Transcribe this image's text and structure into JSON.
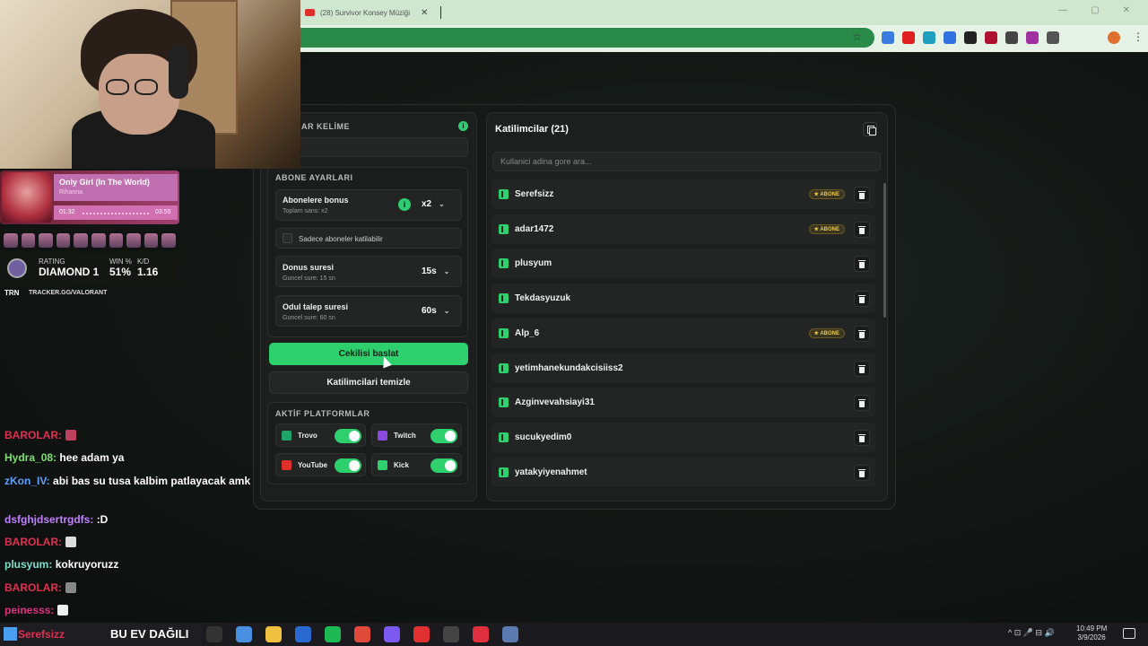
{
  "browser": {
    "tab_title": "(28) Survivor Konsey Müziği",
    "tab_close": "✕",
    "star": "☆",
    "menu": "⋮",
    "window_buttons": [
      "—",
      "▢",
      "✕"
    ],
    "extensions": [
      "#3a7be0",
      "#e02020",
      "#20a0c0",
      "#3070e0",
      "#222222",
      "#b01030",
      "#444444",
      "#a030a0",
      "#555555"
    ]
  },
  "keyword": {
    "title": "AR KELİME",
    "info": "i"
  },
  "abone": {
    "title": "ABONE AYARLARI",
    "bonus": {
      "label": "Abonelere bonus",
      "sub": "Toplam sans: x2",
      "info": "i",
      "value": "x2"
    },
    "only_subs": {
      "label": "Sadece aboneler katilabilir"
    },
    "duration": {
      "label": "Donus suresi",
      "sub": "Guncel sure: 15 sn",
      "value": "15s"
    },
    "claim": {
      "label": "Odul talep suresi",
      "sub": "Guncel sure: 60 sn",
      "value": "60s"
    },
    "chevron": "⌄"
  },
  "buttons": {
    "start": "Cekilisi baslat",
    "clear": "Katilimcilari temizle"
  },
  "platforms": {
    "title": "AKTİF PLATFORMLAR",
    "items": [
      {
        "name": "Trovo",
        "color": "#1fa56a"
      },
      {
        "name": "Twitch",
        "color": "#8a4ae0"
      },
      {
        "name": "YouTube",
        "color": "#e0302a"
      },
      {
        "name": "Kick",
        "color": "#2ed06e"
      }
    ]
  },
  "participants": {
    "title": "Katilimcilar (21)",
    "search_placeholder": "Kullanici adina gore ara...",
    "badge": "★ ABONE",
    "items": [
      {
        "name": "Serefsizz",
        "abone": true
      },
      {
        "name": "adar1472",
        "abone": true
      },
      {
        "name": "plusyum",
        "abone": false
      },
      {
        "name": "Tekdasyuzuk",
        "abone": false
      },
      {
        "name": "Alp_6",
        "abone": true
      },
      {
        "name": "yetimhanekundakcisiiss2",
        "abone": false
      },
      {
        "name": "Azginvevahsiayi31",
        "abone": false
      },
      {
        "name": "sucukyedim0",
        "abone": false
      },
      {
        "name": "yatakyiyenahmet",
        "abone": false
      }
    ]
  },
  "music": {
    "song": "Only Girl (In The World)",
    "artist": "Rihanna",
    "current": "01:32",
    "length": "03:55"
  },
  "rating": {
    "rating_label": "RATING",
    "rating_value": "DIAMOND 1",
    "win_label": "WIN %",
    "win_value": "51%",
    "kd_label": "K/D",
    "kd_value": "1.16",
    "trn": "TRN",
    "url": "TRACKER.GG/VALORANT"
  },
  "chat": [
    {
      "user": "BAROLAR:",
      "color": "#e03050",
      "text": "",
      "emote": "#c04060"
    },
    {
      "user": "Hydra_08:",
      "color": "#7ae06a",
      "text": "hee adam ya"
    },
    {
      "user": "zKon_IV:",
      "color": "#60a0ff",
      "text": "abi bas su tusa kalbim patlayacak amk"
    },
    {
      "user": "dsfghjdsertrgdfs:",
      "color": "#c080ff",
      "text": ":D"
    },
    {
      "user": "BAROLAR:",
      "color": "#e03050",
      "text": "",
      "emote": "#dddddd"
    },
    {
      "user": "plusyum:",
      "color": "#7adfd0",
      "text": "kokruyoruzz"
    },
    {
      "user": "BAROLAR:",
      "color": "#e03050",
      "text": "",
      "emote": "#888888"
    },
    {
      "user": "peinesss:",
      "color": "#e03080",
      "text": "",
      "emote": "#eeeeee"
    }
  ],
  "banner": {
    "user": "Serefsizz",
    "text": "BU EV DAĞILI"
  },
  "taskbar": {
    "icons": [
      "#333333",
      "#4a90e2",
      "#f0c040",
      "#2a6ad0",
      "#1db954",
      "#e04a3a",
      "#7a5af0",
      "#e03030",
      "#444444",
      "#e03040",
      "#5a7ab0"
    ],
    "time": "10:49 PM",
    "date": "3/9/2026",
    "tray": "^ ⊡ 🎤 ⊟ 🔊"
  }
}
